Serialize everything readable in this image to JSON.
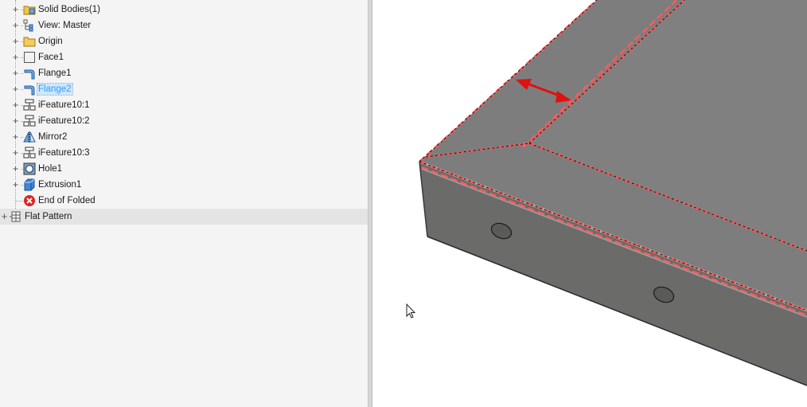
{
  "browser": {
    "items": [
      {
        "label": "Solid Bodies(1)",
        "icon": "solid-bodies-folder-icon",
        "expand": "+"
      },
      {
        "label": "View: Master",
        "icon": "view-representation-icon",
        "expand": "+"
      },
      {
        "label": "Origin",
        "icon": "folder-icon",
        "expand": "+"
      },
      {
        "label": "Face1",
        "icon": "face-feature-icon",
        "expand": "+"
      },
      {
        "label": "Flange1",
        "icon": "flange-feature-icon",
        "expand": "+"
      },
      {
        "label": "Flange2",
        "icon": "flange-feature-icon",
        "expand": "+",
        "selected": true
      },
      {
        "label": "iFeature10:1",
        "icon": "ifeature-icon",
        "expand": "+"
      },
      {
        "label": "iFeature10:2",
        "icon": "ifeature-icon",
        "expand": "+"
      },
      {
        "label": "Mirror2",
        "icon": "mirror-feature-icon",
        "expand": "+"
      },
      {
        "label": "iFeature10:3",
        "icon": "ifeature-icon",
        "expand": "+"
      },
      {
        "label": "Hole1",
        "icon": "hole-feature-icon",
        "expand": "+"
      },
      {
        "label": "Extrusion1",
        "icon": "extrusion-feature-icon",
        "expand": "+"
      },
      {
        "label": "End of Folded",
        "icon": "end-of-part-icon",
        "expand": ""
      }
    ],
    "root": {
      "label": "Flat Pattern",
      "icon": "flat-pattern-icon",
      "expand": "+"
    }
  },
  "colors": {
    "top_face": "#7d7d7d",
    "side_face": "#6b6b69",
    "edge_highlight": "#ff5a5a",
    "arrow": "#e01010",
    "selection": "#3399ff"
  }
}
